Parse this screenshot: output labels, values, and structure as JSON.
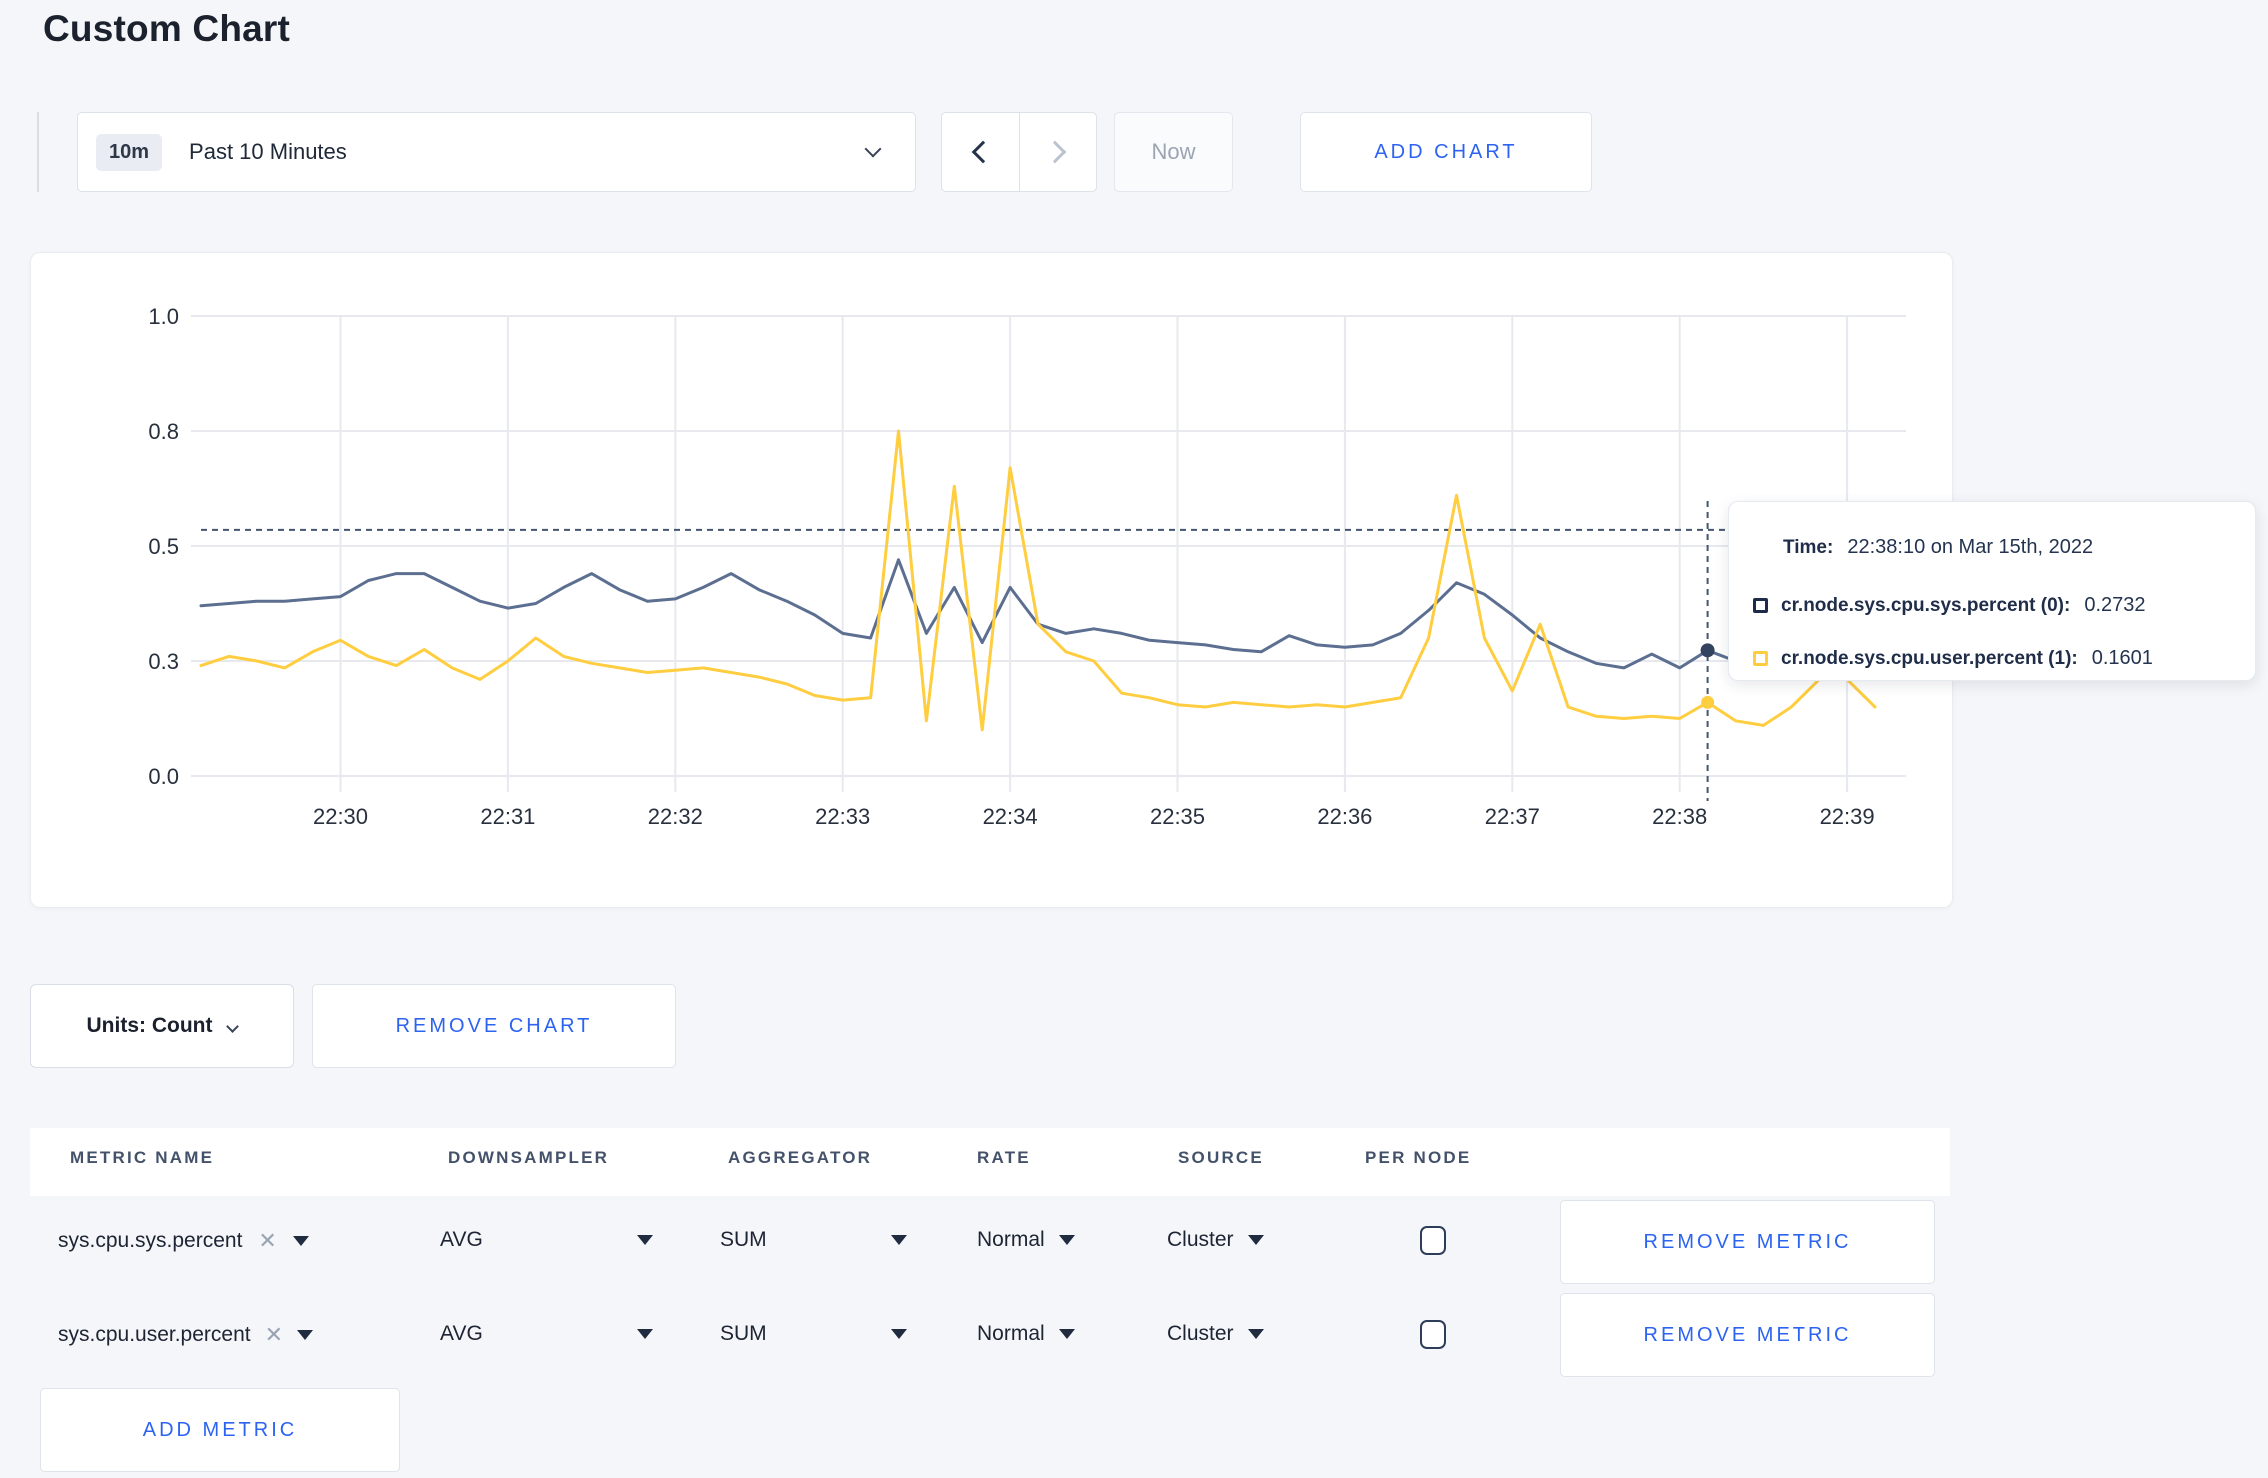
{
  "page": {
    "title": "Custom Chart"
  },
  "toolbar": {
    "range_badge": "10m",
    "range_label": "Past 10 Minutes",
    "now_label": "Now",
    "add_chart_label": "ADD CHART"
  },
  "tooltip": {
    "time_label": "Time:",
    "time_value": "22:38:10 on Mar 15th, 2022",
    "series": [
      {
        "label": "cr.node.sys.cpu.sys.percent (0):",
        "value": "0.2732",
        "color": "#1c2b4a"
      },
      {
        "label": "cr.node.sys.cpu.user.percent (1):",
        "value": "0.1601",
        "color": "#ffcd40"
      }
    ]
  },
  "units": {
    "label": "Units: Count",
    "remove_chart_label": "REMOVE CHART"
  },
  "metrics_table": {
    "headers": [
      "METRIC NAME",
      "DOWNSAMPLER",
      "AGGREGATOR",
      "RATE",
      "SOURCE",
      "PER NODE"
    ],
    "rows": [
      {
        "name": "sys.cpu.sys.percent",
        "downsampler": "AVG",
        "aggregator": "SUM",
        "rate": "Normal",
        "source": "Cluster",
        "per_node_checked": false
      },
      {
        "name": "sys.cpu.user.percent",
        "downsampler": "AVG",
        "aggregator": "SUM",
        "rate": "Normal",
        "source": "Cluster",
        "per_node_checked": false
      }
    ],
    "remove_metric_label": "REMOVE METRIC",
    "add_metric_label": "ADD METRIC"
  },
  "chart_data": {
    "type": "line",
    "title": "",
    "xlabel": "",
    "ylabel": "",
    "ylim": [
      0,
      1
    ],
    "grid": true,
    "x_tick_labels": [
      "22:30",
      "22:31",
      "22:32",
      "22:33",
      "22:34",
      "22:35",
      "22:36",
      "22:37",
      "22:38",
      "22:39"
    ],
    "y_tick_labels": [
      "0.0",
      "0.3",
      "0.5",
      "0.8",
      "1.0"
    ],
    "x_start": "22:29:10",
    "interval_seconds": 10,
    "series": [
      {
        "name": "cr.node.sys.cpu.sys.percent",
        "color": "#5c6f91",
        "values": [
          0.37,
          0.375,
          0.38,
          0.38,
          0.385,
          0.39,
          0.425,
          0.44,
          0.44,
          0.41,
          0.38,
          0.365,
          0.375,
          0.41,
          0.44,
          0.405,
          0.38,
          0.385,
          0.41,
          0.44,
          0.405,
          0.38,
          0.35,
          0.31,
          0.3,
          0.47,
          0.31,
          0.41,
          0.29,
          0.41,
          0.33,
          0.31,
          0.32,
          0.31,
          0.295,
          0.29,
          0.285,
          0.275,
          0.27,
          0.305,
          0.285,
          0.28,
          0.285,
          0.31,
          0.36,
          0.42,
          0.395,
          0.35,
          0.3,
          0.27,
          0.245,
          0.235,
          0.265,
          0.235,
          0.273,
          0.25,
          0.26,
          0.255,
          0.26,
          0.255,
          0.26
        ]
      },
      {
        "name": "cr.node.sys.cpu.user.percent",
        "color": "#ffcd40",
        "values": [
          0.24,
          0.26,
          0.25,
          0.235,
          0.27,
          0.295,
          0.26,
          0.24,
          0.275,
          0.235,
          0.21,
          0.25,
          0.3,
          0.26,
          0.245,
          0.235,
          0.225,
          0.23,
          0.235,
          0.225,
          0.215,
          0.2,
          0.175,
          0.165,
          0.17,
          0.75,
          0.12,
          0.63,
          0.1,
          0.67,
          0.33,
          0.27,
          0.25,
          0.18,
          0.17,
          0.155,
          0.15,
          0.16,
          0.155,
          0.15,
          0.155,
          0.15,
          0.16,
          0.17,
          0.3,
          0.61,
          0.3,
          0.185,
          0.33,
          0.15,
          0.13,
          0.125,
          0.13,
          0.125,
          0.1601,
          0.12,
          0.11,
          0.15,
          0.21,
          0.21,
          0.15
        ]
      }
    ],
    "crosshair": {
      "time": "22:38:10",
      "index": 54,
      "hover_value": 0.535,
      "sys_value": 0.2732,
      "user_value": 0.1601
    }
  }
}
